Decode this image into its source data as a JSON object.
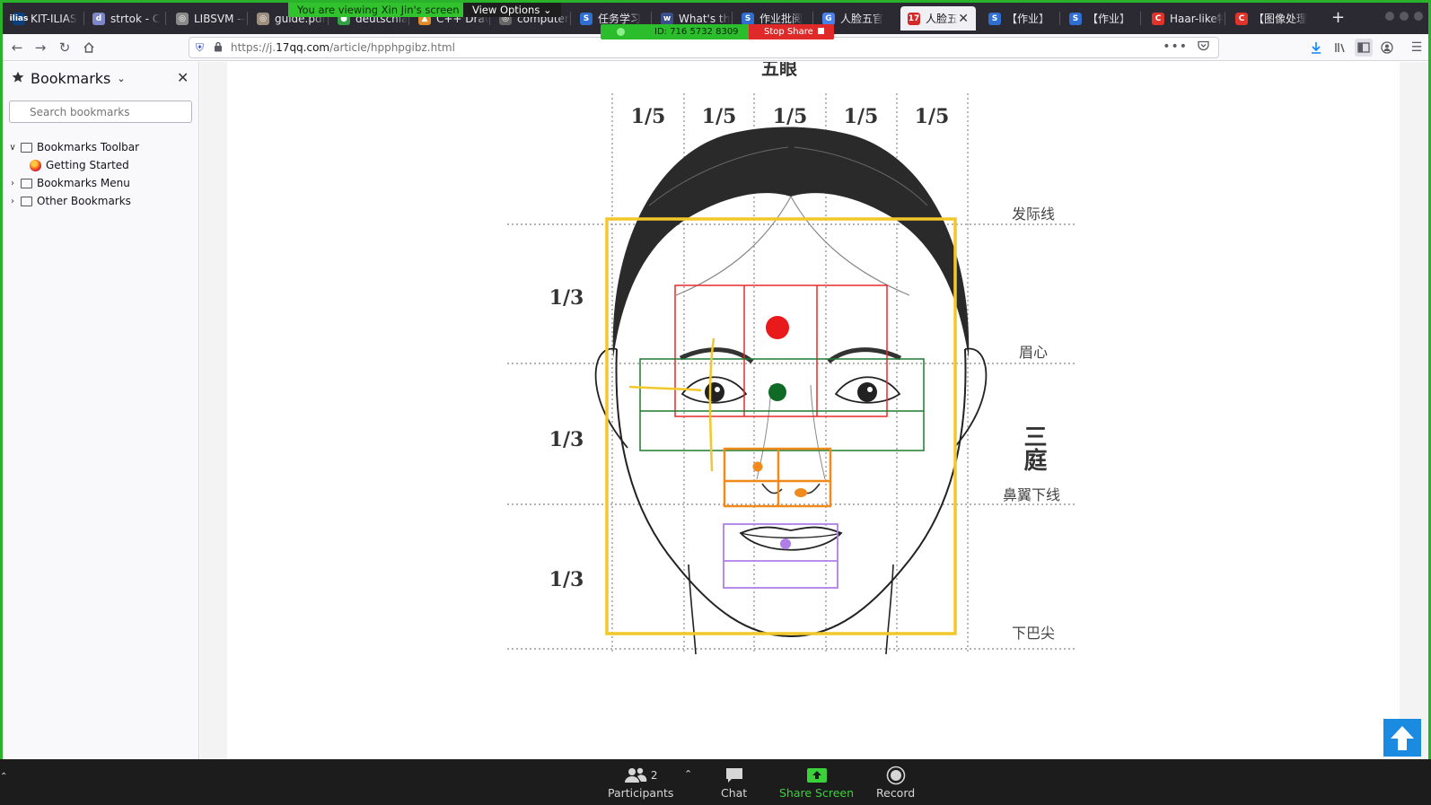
{
  "zoom": {
    "viewing_banner": "You are viewing Xin Jin's screen",
    "view_options": "View Options",
    "meeting_id": "ID: 716 5732 8309",
    "stop_share": "Stop Share",
    "participants_count": "2",
    "toolbar": {
      "participants": "Participants",
      "chat": "Chat",
      "share_screen": "Share Screen",
      "record": "Record"
    },
    "colors": {
      "share_green": "#3ad13a",
      "stop_red": "#e02a2a",
      "frame_green": "#2ab32a"
    }
  },
  "browser": {
    "tabs": [
      {
        "label": "KIT-ILIAS",
        "favicon": "ilias-icon",
        "fav_text": "ilias",
        "fav_color": "#0b3f80"
      },
      {
        "label": "strtok - C",
        "favicon": "discord-icon",
        "fav_text": "d",
        "fav_color": "#7d86c7"
      },
      {
        "label": "LIBSVM --",
        "favicon": "globe-icon",
        "fav_text": "◎",
        "fav_color": "#8a8a8a"
      },
      {
        "label": "guide.pdf",
        "favicon": "pdf-icon",
        "fav_text": "◎",
        "fav_color": "#9c8f7e"
      },
      {
        "label": "deutschlan",
        "favicon": "green-globe-icon",
        "fav_text": "●",
        "fav_color": "#33a047"
      },
      {
        "label": "C++ Draw",
        "favicon": "drive-icon",
        "fav_text": "▲",
        "fav_color": "#e08a2a"
      },
      {
        "label": "computer",
        "favicon": "globe-icon",
        "fav_text": "◎",
        "fav_color": "#666"
      },
      {
        "label": "任务学习",
        "favicon": "s-icon",
        "fav_text": "S",
        "fav_color": "#2e6fd1"
      },
      {
        "label": "What's th",
        "favicon": "ilias-icon",
        "fav_text": "w",
        "fav_color": "#3b4f8a"
      },
      {
        "label": "作业批阅",
        "favicon": "s-icon",
        "fav_text": "S",
        "fav_color": "#2e6fd1"
      },
      {
        "label": "人脸五官",
        "favicon": "google-icon",
        "fav_text": "G",
        "fav_color": "#4a80e8"
      },
      {
        "label": "人脸五",
        "favicon": "17qq-icon",
        "fav_text": "17",
        "fav_color": "#d22a2a",
        "active": true
      },
      {
        "label": "【作业】",
        "favicon": "s-icon",
        "fav_text": "S",
        "fav_color": "#2e6fd1"
      },
      {
        "label": "【作业】",
        "favicon": "s-icon",
        "fav_text": "S",
        "fav_color": "#2e6fd1"
      },
      {
        "label": "Haar-like特",
        "favicon": "csdn-icon",
        "fav_text": "C",
        "fav_color": "#e0332a"
      },
      {
        "label": "【图像处理",
        "favicon": "csdn-icon",
        "fav_text": "C",
        "fav_color": "#e0332a"
      }
    ],
    "url_prefix": "https://j.",
    "url_domain": "17qq.com",
    "url_path": "/article/hpphpgibz.html"
  },
  "sidebar": {
    "title": "Bookmarks",
    "search_placeholder": "Search bookmarks",
    "items": [
      {
        "label": "Bookmarks Toolbar",
        "expanded": true,
        "level": 0,
        "icon": "toolbar-folder-icon"
      },
      {
        "label": "Getting Started",
        "level": 1,
        "icon": "firefox-icon"
      },
      {
        "label": "Bookmarks Menu",
        "expanded": false,
        "level": 0,
        "icon": "menu-folder-icon"
      },
      {
        "label": "Other Bookmarks",
        "expanded": false,
        "level": 0,
        "icon": "folder-icon"
      }
    ]
  },
  "diagram": {
    "heading": "五眼",
    "fifths": [
      "1/5",
      "1/5",
      "1/5",
      "1/5",
      "1/5"
    ],
    "thirds": [
      "1/3",
      "1/3",
      "1/3"
    ],
    "right_labels": [
      "发际线",
      "眉心",
      "鼻翼下线",
      "下巴尖"
    ],
    "three_court_label": "三庭",
    "annotation_colors": {
      "face_box": "#f2c72a",
      "forehead": "#e82a2a",
      "eyes": "#1f7a2e",
      "nose": "#f08a1a",
      "mouth": "#b07ee8"
    }
  }
}
